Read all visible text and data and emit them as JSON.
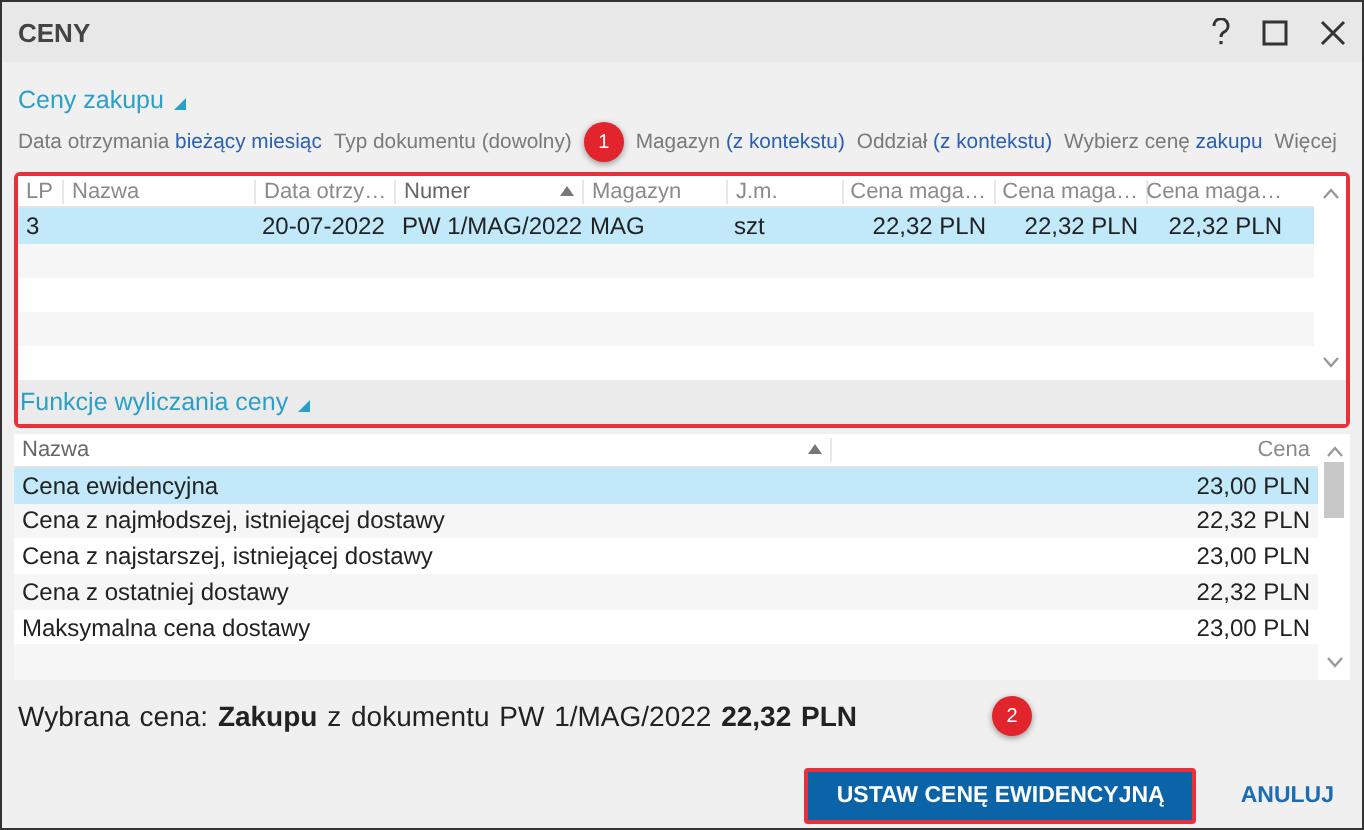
{
  "window": {
    "title": "CENY"
  },
  "purchase_section": {
    "title": "Ceny zakupu",
    "expanded": true
  },
  "filters": [
    {
      "label": "Data otrzymania",
      "value": "bieżący miesiąc"
    },
    {
      "label": "Typ dokumentu (dowolny)"
    },
    {
      "label": "Magazyn",
      "value": "(z kontekstu)"
    },
    {
      "label": "Oddział",
      "value": "(z kontekstu)"
    },
    {
      "label": "Wybierz cenę",
      "value": "zakupu"
    },
    {
      "label": "Więcej"
    }
  ],
  "purchase_table": {
    "columns": [
      {
        "label": "LP",
        "sorted": false
      },
      {
        "label": "Nazwa",
        "sorted": false
      },
      {
        "label": "Data otrzy…",
        "sorted": false
      },
      {
        "label": "Numer",
        "sorted": true
      },
      {
        "label": "Magazyn",
        "sorted": false
      },
      {
        "label": "J.m.",
        "sorted": false
      },
      {
        "label": "Cena maga…",
        "sorted": false
      },
      {
        "label": "Cena maga…",
        "sorted": false
      },
      {
        "label": "Cena maga…",
        "sorted": false
      }
    ],
    "rows": [
      {
        "cells": [
          "3",
          "",
          "20-07-2022",
          "PW 1/MAG/2022",
          "MAG",
          "szt",
          "22,32 PLN",
          "22,32 PLN",
          "22,32 PLN"
        ],
        "selected": true
      }
    ]
  },
  "functions_section": {
    "title": "Funkcje wyliczania ceny",
    "expanded": true
  },
  "functions_table": {
    "columns": [
      {
        "label": "Nazwa",
        "sorted": true
      },
      {
        "label": "Cena",
        "sorted": false
      }
    ],
    "rows": [
      {
        "cells": [
          "Cena ewidencyjna",
          "23,00 PLN"
        ],
        "selected": true
      },
      {
        "cells": [
          "Cena z najmłodszej, istniejącej dostawy",
          "22,32 PLN"
        ],
        "selected": false
      },
      {
        "cells": [
          "Cena z najstarszej, istniejącej dostawy",
          "23,00 PLN"
        ],
        "selected": false
      },
      {
        "cells": [
          "Cena z ostatniej dostawy",
          "22,32 PLN"
        ],
        "selected": false
      },
      {
        "cells": [
          "Maksymalna cena dostawy",
          "23,00 PLN"
        ],
        "selected": false
      }
    ]
  },
  "summary": "Wybrana cena: **Zakupu** z dokumentu PW 1/MAG/2022 **22,32 PLN**",
  "buttons": [
    {
      "label": "USTAW CENĘ EWIDENCYJNĄ",
      "kind": "primary"
    },
    {
      "label": "ANULUJ",
      "kind": "link"
    }
  ],
  "annotations": [
    {
      "label": "1"
    },
    {
      "label": "2"
    }
  ]
}
